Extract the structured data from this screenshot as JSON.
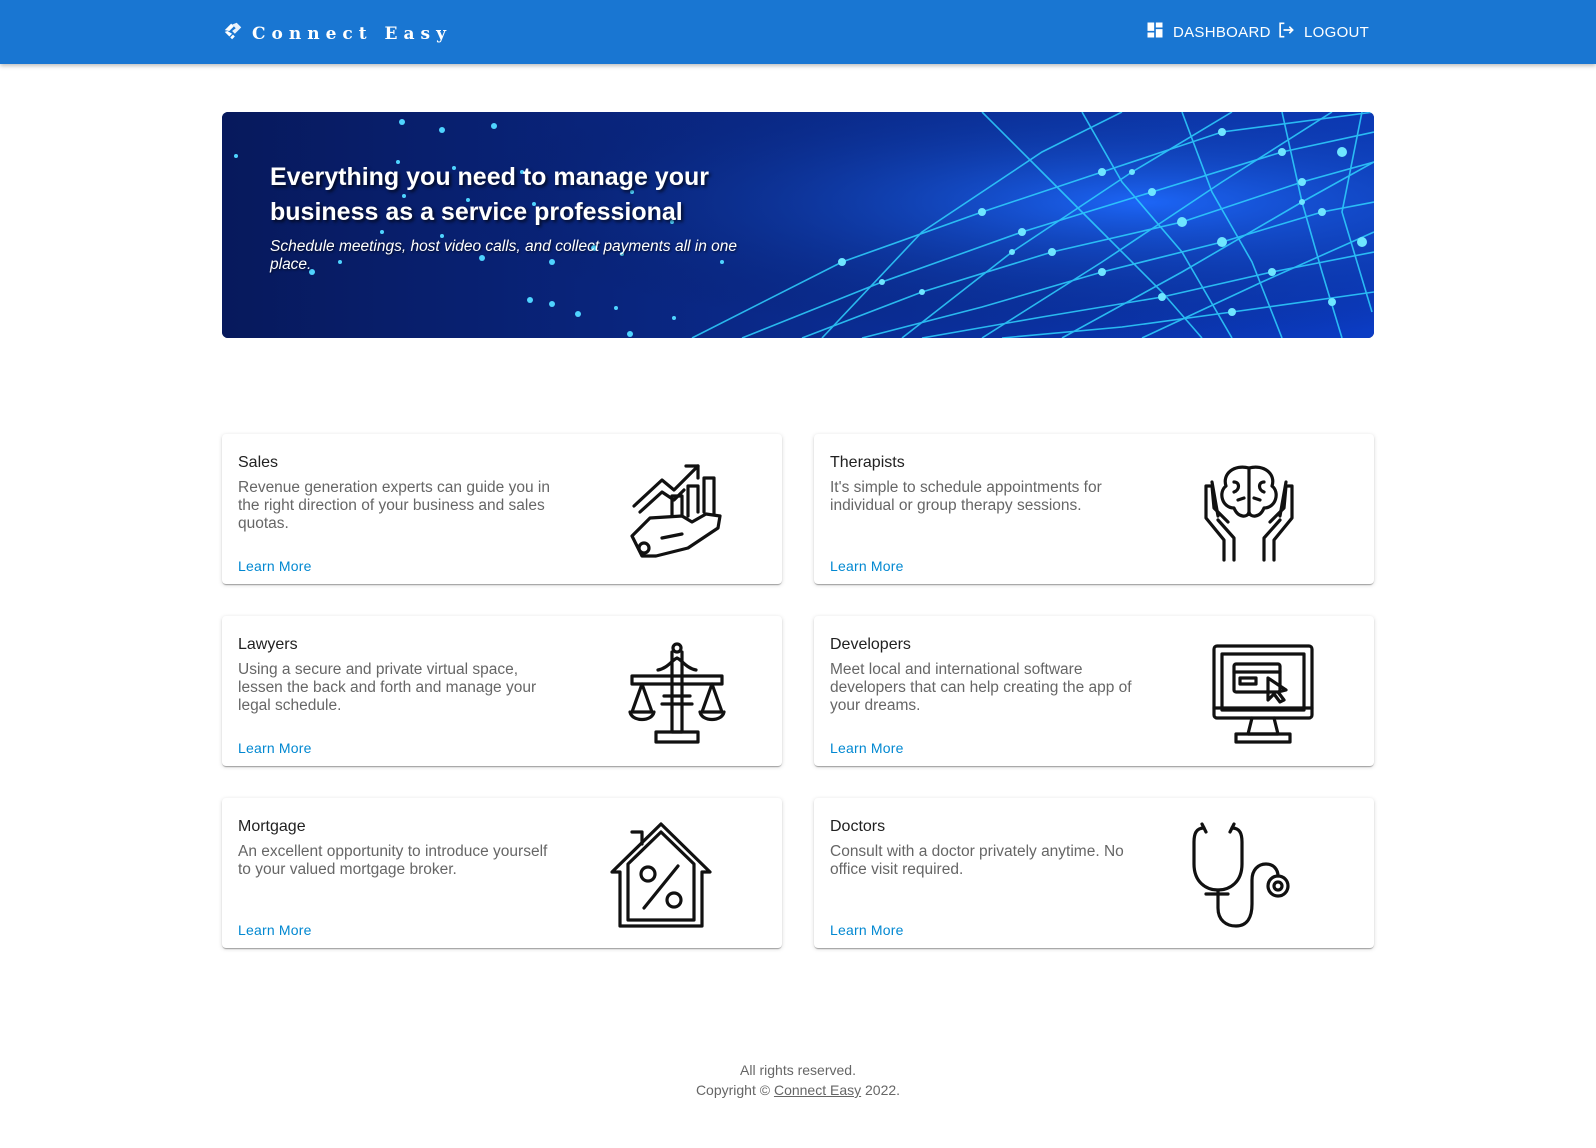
{
  "header": {
    "brand": "Connect Easy",
    "nav": [
      {
        "label": "DASHBOARD",
        "icon": "dashboard-icon"
      },
      {
        "label": "LOGOUT",
        "icon": "logout-icon"
      }
    ]
  },
  "hero": {
    "title": "Everything you need to manage your business as a service professional",
    "subtitle": "Schedule meetings, host video calls, and collect payments all in one place."
  },
  "cards": [
    {
      "title": "Sales",
      "description": "Revenue generation experts can guide you in the right direction of your business and sales quotas.",
      "link": "Learn More",
      "icon": "sales-growth-hand-icon"
    },
    {
      "title": "Therapists",
      "description": "It's simple to schedule appointments for individual or group therapy sessions.",
      "link": "Learn More",
      "icon": "brain-hands-icon"
    },
    {
      "title": "Lawyers",
      "description": "Using a secure and private virtual space, lessen the back and forth and manage your legal schedule.",
      "link": "Learn More",
      "icon": "scales-of-justice-icon"
    },
    {
      "title": "Developers",
      "description": "Meet local and international software developers that can help creating the app of your dreams.",
      "link": "Learn More",
      "icon": "monitor-cursor-icon"
    },
    {
      "title": "Mortgage",
      "description": "An excellent opportunity to introduce yourself to your valued mortgage broker.",
      "link": "Learn More",
      "icon": "house-percent-icon"
    },
    {
      "title": "Doctors",
      "description": "Consult with a doctor privately anytime. No office visit required.",
      "link": "Learn More",
      "icon": "stethoscope-icon"
    }
  ],
  "footer": {
    "rights": "All rights reserved.",
    "copyright_prefix": "Copyright ©",
    "link": "Connect Easy",
    "year": "2022."
  },
  "colors": {
    "appbar": "#1976d2",
    "link": "#0288d1",
    "hero_bg": "#061a5a"
  }
}
